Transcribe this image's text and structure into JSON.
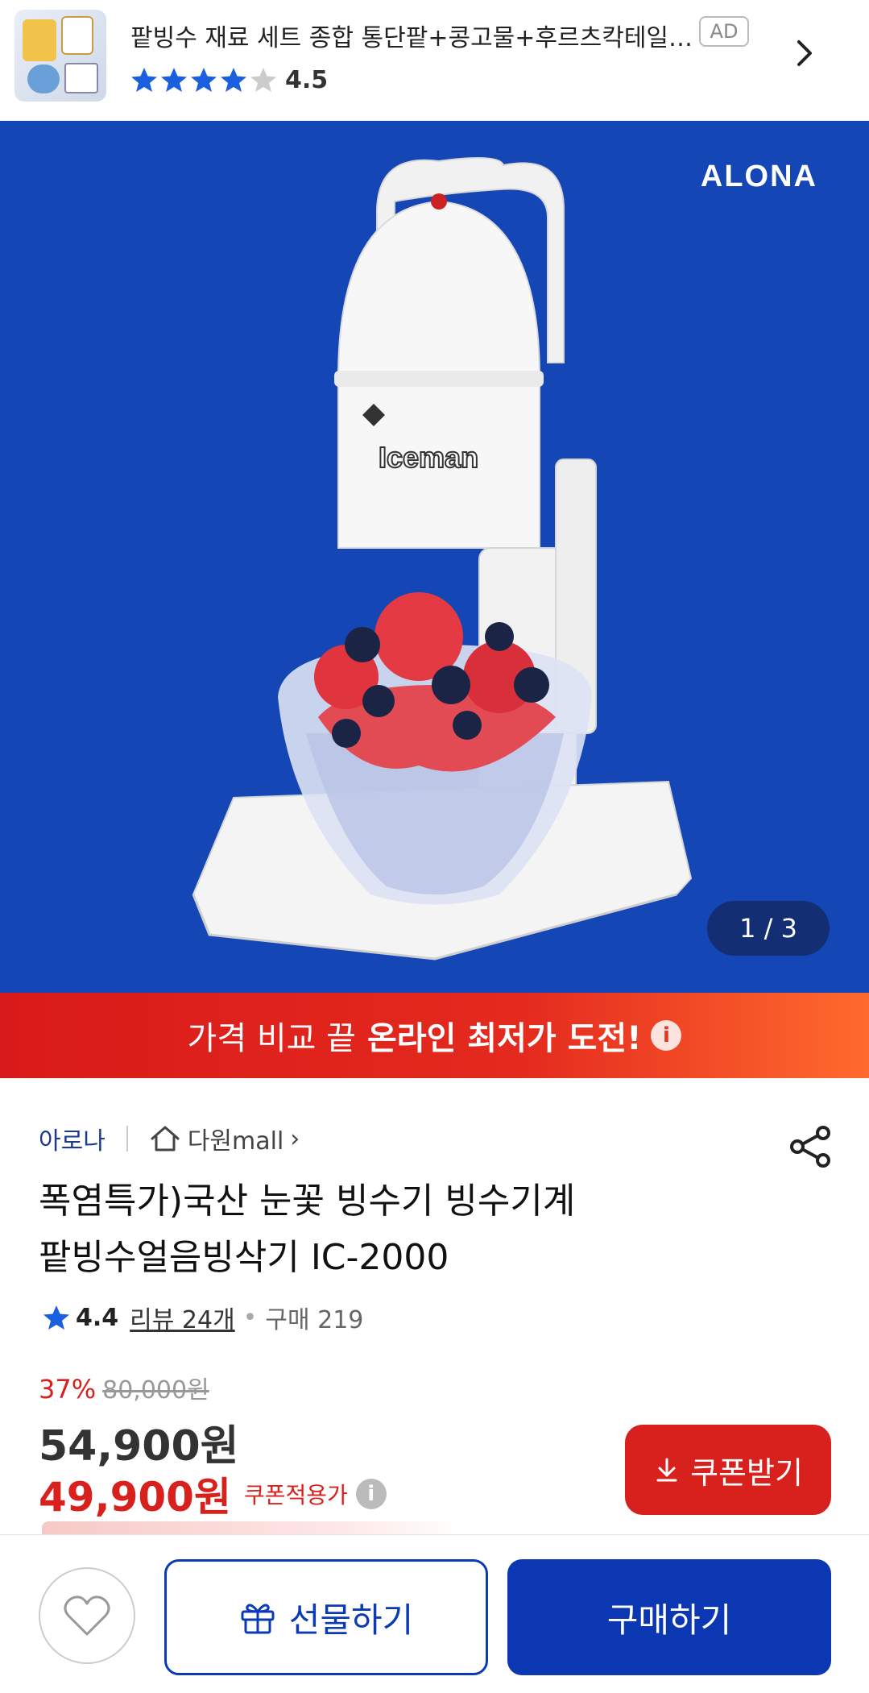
{
  "ad": {
    "title": "팥빙수 재료 세트 종합 통단팥+콩고물+후르츠칵테일+...",
    "badge": "AD",
    "rating": "4.5",
    "stars": 4.5
  },
  "hero": {
    "brand_logo": "ALONA",
    "product_label": "Iceman",
    "counter": "1 / 3"
  },
  "promo": {
    "text": "가격 비교 끝",
    "emphasis": "온라인 최저가 도전!",
    "info_icon": "i"
  },
  "product": {
    "brand": "아로나",
    "store": "다원mall",
    "store_chevron": "›",
    "title_line1": "폭염특가)국산 눈꽃 빙수기 빙수기계",
    "title_line2": "팥빙수얼음빙삭기 IC-2000",
    "rating": "4.4",
    "reviews": "리뷰 24개",
    "dot": "•",
    "purchases": "구매 219"
  },
  "pricing": {
    "discount": "37%",
    "original_price": "80,000원",
    "price": "54,900원",
    "coupon_price": "49,900원",
    "coupon_label": "쿠폰적용가",
    "coupon_info": "i",
    "coupon_button": "쿠폰받기"
  },
  "bottom": {
    "gift_button": "선물하기",
    "buy_button": "구매하기"
  },
  "colors": {
    "accent_blue": "#0b37b3",
    "accent_red": "#d8201d",
    "hero_bg": "#1446b6",
    "star": "#1a5fe0"
  }
}
